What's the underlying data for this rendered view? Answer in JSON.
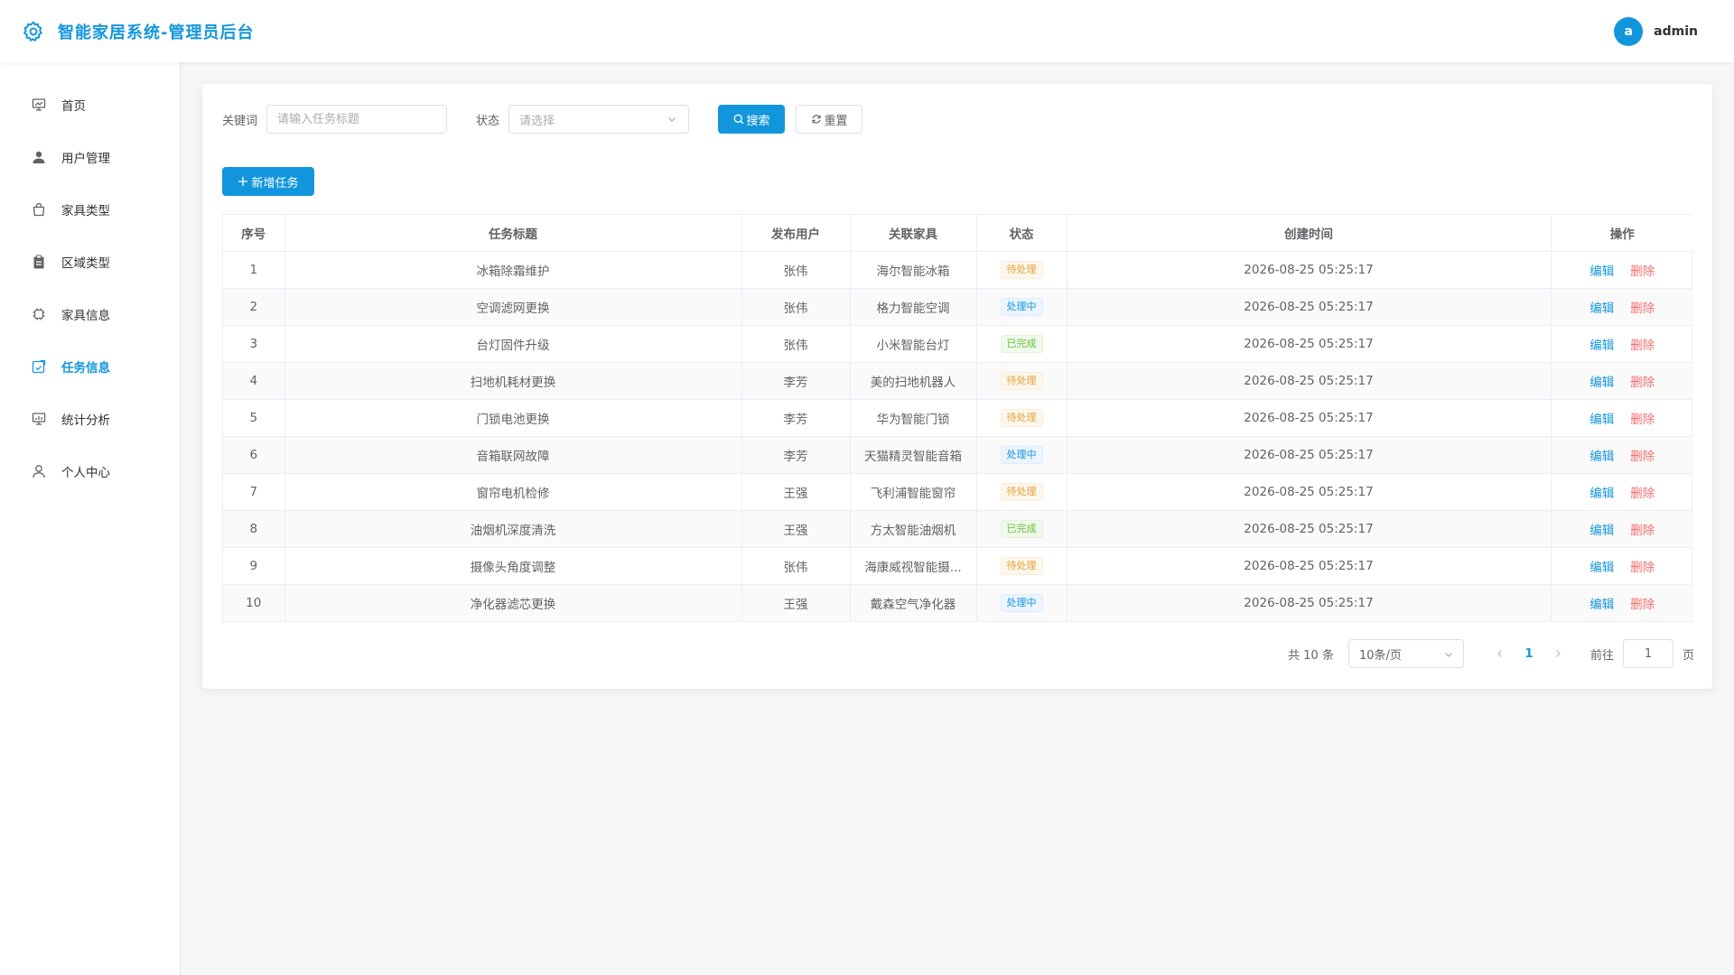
{
  "app": {
    "title": "智能家居系统-管理员后台"
  },
  "user": {
    "avatar_letter": "a",
    "name": "admin"
  },
  "colors": {
    "primary": "#1296db",
    "danger": "#f56c6c",
    "warning": "#e6a23c",
    "success": "#67c23a"
  },
  "sidebar": {
    "items": [
      {
        "label": "首页",
        "icon": "presentation-board-icon",
        "active": false
      },
      {
        "label": "用户管理",
        "icon": "user-icon",
        "active": false
      },
      {
        "label": "家具类型",
        "icon": "shopping-bag-icon",
        "active": false
      },
      {
        "label": "区域类型",
        "icon": "clipboard-icon",
        "active": false
      },
      {
        "label": "家具信息",
        "icon": "chip-icon",
        "active": false
      },
      {
        "label": "任务信息",
        "icon": "task-icon",
        "active": true
      },
      {
        "label": "统计分析",
        "icon": "chart-board-icon",
        "active": false
      },
      {
        "label": "个人中心",
        "icon": "person-outline-icon",
        "active": false
      }
    ]
  },
  "search": {
    "keyword_label": "关键词",
    "keyword_placeholder": "请输入任务标题",
    "status_label": "状态",
    "status_placeholder": "请选择",
    "search_button": "搜索",
    "reset_button": "重置"
  },
  "toolbar": {
    "add_button": "新增任务"
  },
  "table": {
    "columns": [
      "序号",
      "任务标题",
      "发布用户",
      "关联家具",
      "状态",
      "创建时间",
      "操作"
    ],
    "edit_label": "编辑",
    "delete_label": "删除",
    "rows": [
      {
        "index": "1",
        "title": "冰箱除霜维护",
        "user": "张伟",
        "furniture": "海尔智能冰箱",
        "status": "待处理",
        "time": "2026-08-25 05:25:17"
      },
      {
        "index": "2",
        "title": "空调滤网更换",
        "user": "张伟",
        "furniture": "格力智能空调",
        "status": "处理中",
        "time": "2026-08-25 05:25:17"
      },
      {
        "index": "3",
        "title": "台灯固件升级",
        "user": "张伟",
        "furniture": "小米智能台灯",
        "status": "已完成",
        "time": "2026-08-25 05:25:17"
      },
      {
        "index": "4",
        "title": "扫地机耗材更换",
        "user": "李芳",
        "furniture": "美的扫地机器人",
        "status": "待处理",
        "time": "2026-08-25 05:25:17"
      },
      {
        "index": "5",
        "title": "门锁电池更换",
        "user": "李芳",
        "furniture": "华为智能门锁",
        "status": "待处理",
        "time": "2026-08-25 05:25:17"
      },
      {
        "index": "6",
        "title": "音箱联网故障",
        "user": "李芳",
        "furniture": "天猫精灵智能音箱",
        "status": "处理中",
        "time": "2026-08-25 05:25:17"
      },
      {
        "index": "7",
        "title": "窗帘电机检修",
        "user": "王强",
        "furniture": "飞利浦智能窗帘",
        "status": "待处理",
        "time": "2026-08-25 05:25:17"
      },
      {
        "index": "8",
        "title": "油烟机深度清洗",
        "user": "王强",
        "furniture": "方太智能油烟机",
        "status": "已完成",
        "time": "2026-08-25 05:25:17"
      },
      {
        "index": "9",
        "title": "摄像头角度调整",
        "user": "张伟",
        "furniture": "海康威视智能摄...",
        "status": "待处理",
        "time": "2026-08-25 05:25:17"
      },
      {
        "index": "10",
        "title": "净化器滤芯更换",
        "user": "王强",
        "furniture": "戴森空气净化器",
        "status": "处理中",
        "time": "2026-08-25 05:25:17"
      }
    ]
  },
  "pagination": {
    "total_text": "共 10 条",
    "page_size": "10条/页",
    "current_page": "1",
    "goto_label": "前往",
    "goto_value": "1",
    "page_suffix": "页"
  }
}
